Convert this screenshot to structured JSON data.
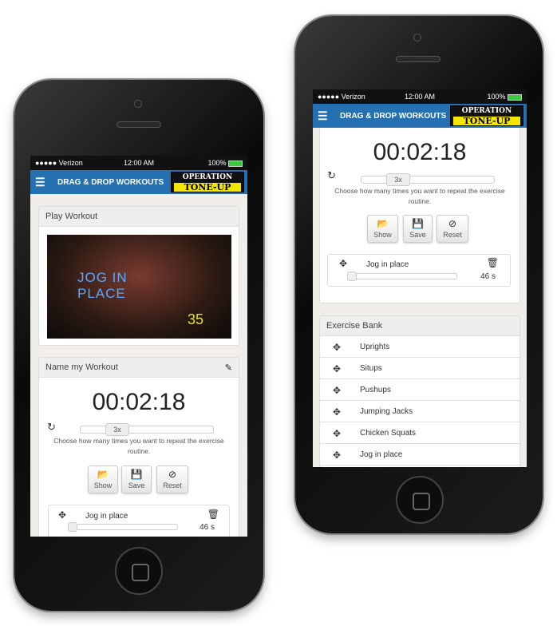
{
  "status": {
    "carrier": "●●●●● Verizon",
    "time": "12:00 AM",
    "battery": "100%"
  },
  "header": {
    "title": "DRAG & DROP WORKOUTS",
    "logo_top": "OPERATION",
    "logo_bottom": "TONE-UP",
    "menu_icon": "☰"
  },
  "left": {
    "play_panel": {
      "title": "Play Workout",
      "video_caption": "JOG IN PLACE",
      "video_counter": "35"
    },
    "name_panel": {
      "title": "Name my Workout",
      "edit_icon": "✎"
    },
    "timer": "00:02:18",
    "repeat": "3x",
    "repeat_fraction": 0.3,
    "help": "Choose how many times you want to repeat the exercise routine.",
    "buttons": {
      "show": "Show",
      "save": "Save",
      "reset": "Reset"
    },
    "exercise": {
      "name": "Jog in place",
      "duration": "46 s"
    }
  },
  "right": {
    "timer": "00:02:18",
    "repeat": "3x",
    "repeat_fraction": 0.3,
    "help": "Choose how many times you want to repeat the exercise routine.",
    "buttons": {
      "show": "Show",
      "save": "Save",
      "reset": "Reset"
    },
    "exercise": {
      "name": "Jog in place",
      "duration": "46 s"
    },
    "bank": {
      "title": "Exercise Bank",
      "items": [
        "Uprights",
        "Situps",
        "Pushups",
        "Jumping Jacks",
        "Chicken Squats",
        "Jog in place"
      ]
    }
  },
  "colors": {
    "header": "#2470b0",
    "logo_yellow": "#f5e600"
  }
}
